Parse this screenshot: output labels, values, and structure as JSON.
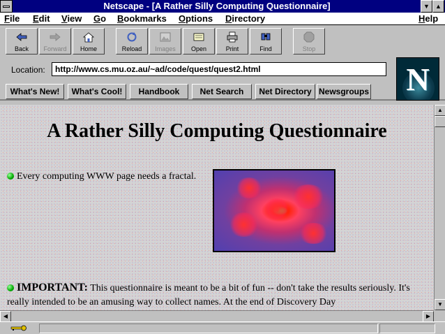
{
  "window": {
    "title": "Netscape - [A Rather Silly Computing Questionnaire]",
    "buttons": {
      "minimize": "▼",
      "maximize": "▲"
    }
  },
  "menubar": {
    "items": [
      {
        "label": "File",
        "accel": "F",
        "rest": "ile"
      },
      {
        "label": "Edit",
        "accel": "E",
        "rest": "dit"
      },
      {
        "label": "View",
        "accel": "V",
        "rest": "iew"
      },
      {
        "label": "Go",
        "accel": "G",
        "rest": "o"
      },
      {
        "label": "Bookmarks",
        "accel": "B",
        "rest": "ookmarks"
      },
      {
        "label": "Options",
        "accel": "O",
        "rest": "ptions"
      },
      {
        "label": "Directory",
        "accel": "D",
        "rest": "irectory"
      },
      {
        "label": "Help",
        "accel": "H",
        "rest": "elp"
      }
    ]
  },
  "toolbar": {
    "buttons": [
      {
        "label": "Back",
        "icon": "back-arrow-icon",
        "enabled": true
      },
      {
        "label": "Forward",
        "icon": "forward-arrow-icon",
        "enabled": false
      },
      {
        "label": "Home",
        "icon": "home-icon",
        "enabled": true
      },
      {
        "label": "Reload",
        "icon": "reload-icon",
        "enabled": true
      },
      {
        "label": "Images",
        "icon": "images-icon",
        "enabled": false
      },
      {
        "label": "Open",
        "icon": "open-icon",
        "enabled": true
      },
      {
        "label": "Print",
        "icon": "print-icon",
        "enabled": true
      },
      {
        "label": "Find",
        "icon": "find-icon",
        "enabled": true
      },
      {
        "label": "Stop",
        "icon": "stop-icon",
        "enabled": false
      }
    ]
  },
  "location": {
    "label": "Location:",
    "url": "http://www.cs.mu.oz.au/~ad/code/quest/quest2.html"
  },
  "logo": {
    "letter": "N"
  },
  "directory_buttons": [
    "What's New!",
    "What's Cool!",
    "Handbook",
    "Net Search",
    "Net Directory",
    "Newsgroups"
  ],
  "content": {
    "heading": "A Rather Silly Computing Questionnaire",
    "line1": "Every computing WWW page needs a fractal.",
    "important_label": "IMPORTANT:",
    "important_text": " This questionnaire is meant to be a bit of fun -- don't take the results seriously. It's really intended to be an amusing way to collect names. At the end of Discovery Day"
  },
  "colors": {
    "titlebar": "#000080",
    "chrome": "#c0c0c0",
    "bullet": "#00aa00"
  }
}
